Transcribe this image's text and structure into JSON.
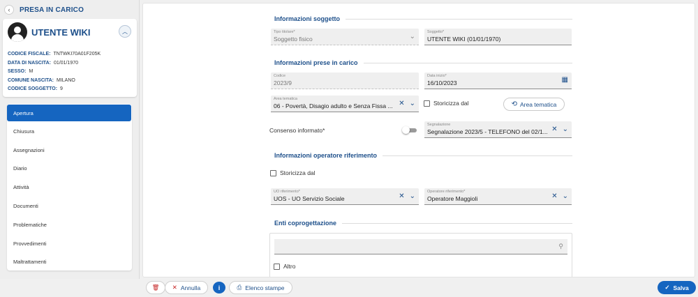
{
  "sidebar": {
    "title": "PRESA IN CARICO",
    "user": {
      "name": "UTENTE WIKI",
      "info": [
        {
          "label": "CODICE FISCALE:",
          "value": "TNTWKI70A01F205K"
        },
        {
          "label": "DATA DI NASCITA:",
          "value": "01/01/1970"
        },
        {
          "label": "SESSO:",
          "value": "M"
        },
        {
          "label": "COMUNE NASCITA:",
          "value": "MILANO"
        },
        {
          "label": "CODICE SOGGETTO:",
          "value": "9"
        }
      ]
    },
    "menu": [
      {
        "label": "Apertura",
        "active": true
      },
      {
        "label": "Chiusura"
      },
      {
        "label": "Assegnazioni"
      },
      {
        "label": "Diario"
      },
      {
        "label": "Attività"
      },
      {
        "label": "Documenti"
      },
      {
        "label": "Problematiche"
      },
      {
        "label": "Provvedimenti"
      },
      {
        "label": "Maltrattamenti"
      }
    ]
  },
  "main": {
    "sections": {
      "soggetto": "Informazioni soggetto",
      "presa": "Informazioni prese in carico",
      "operatore": "Informazioni operatore riferimento",
      "enti": "Enti coprogettazione"
    },
    "fields": {
      "tipo_titolare": {
        "label": "Tipo titolare*",
        "value": "Soggetto fisico"
      },
      "soggetto": {
        "label": "Soggetto*",
        "value": "UTENTE WIKI (01/01/1970)"
      },
      "codice": {
        "label": "Codice",
        "value": "2023/9"
      },
      "data_inizio": {
        "label": "Data inizio*",
        "value": "16/10/2023"
      },
      "area_tematica": {
        "label": "Area tematica",
        "value": "06 - Povertà, Disagio adulto e Senza Fissa ..."
      },
      "segnalazione": {
        "label": "Segnalazione",
        "value": "Segnalazione 2023/5 - TELEFONO del 02/1..."
      },
      "uo_riferimento": {
        "label": "UO riferimento*",
        "value": "UOS - UO Servizio Sociale"
      },
      "operatore_riferimento": {
        "label": "Operatore riferimento*",
        "value": "Operatore Maggioli"
      }
    },
    "storicizza_label": "Storicizza dal",
    "area_tematica_button": "Area tematica",
    "consenso_label": "Consenso informato*",
    "enti_items": [
      "Altro"
    ],
    "enti_search_placeholder": ""
  },
  "footer": {
    "annulla": "Annulla",
    "elenco_stampe": "Elenco stampe",
    "salva": "Salva"
  },
  "colors": {
    "accent": "#1565c0",
    "title": "#1d4f8a",
    "danger": "#c62828"
  }
}
